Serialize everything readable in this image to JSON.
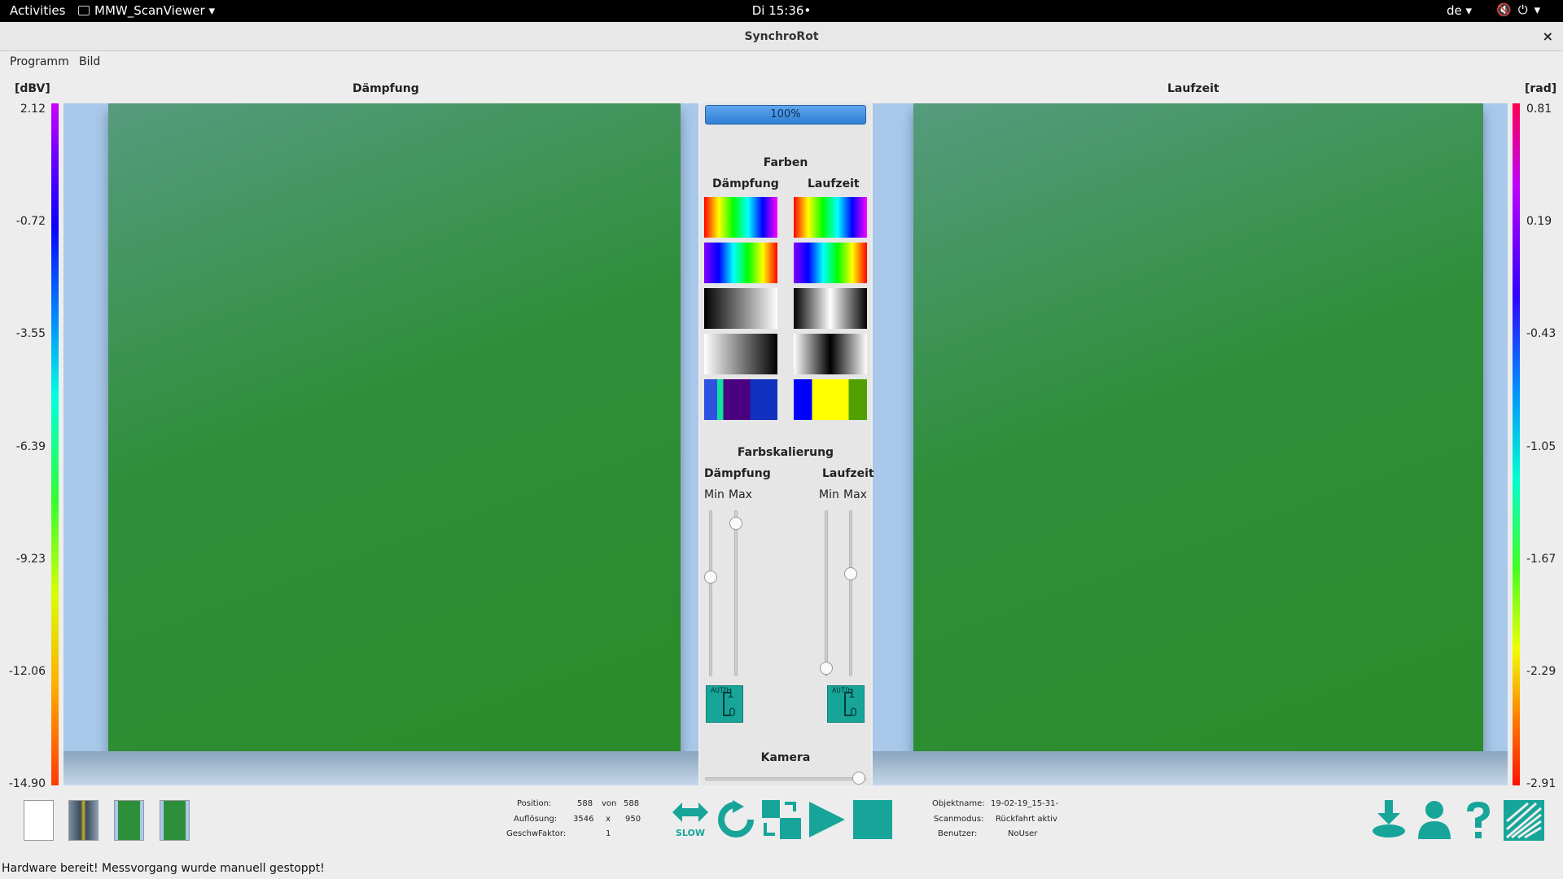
{
  "topbar": {
    "activities": "Activities",
    "app_menu": "MMW_ScanViewer",
    "clock": "Di 15:36",
    "language": "de"
  },
  "window": {
    "title": "SynchroRot",
    "close": "×"
  },
  "menu": {
    "items": [
      "Programm",
      "Bild"
    ]
  },
  "left_panel": {
    "title": "Dämpfung",
    "unit": "[dBV]",
    "ticks": [
      "2.12",
      "-0.72",
      "-3.55",
      "-6.39",
      "-9.23",
      "-12.06",
      "-14.90"
    ]
  },
  "right_panel": {
    "title": "Laufzeit",
    "unit": "[rad]",
    "ticks": [
      "0.81",
      "0.19",
      "-0.43",
      "-1.05",
      "-1.67",
      "-2.29",
      "-2.91"
    ]
  },
  "controls": {
    "progress_text": "100%",
    "progress_value": 1.0,
    "farben_title": "Farben",
    "farben_damp": "Dämpfung",
    "farben_lauf": "Laufzeit",
    "skalierung_title": "Farbskalierung",
    "skal_damp": "Dämpfung",
    "skal_lauf": "Laufzeit",
    "min": "Min",
    "max": "Max",
    "auto_text": "AUTO",
    "auto_one": "1",
    "auto_zero": "0",
    "kamera_title": "Kamera",
    "slider_levels": {
      "damp_min": 0.6,
      "damp_max": 0.92,
      "lauf_min": 0.05,
      "lauf_max": 0.62,
      "kamera": 1.0
    }
  },
  "info": {
    "position_label": "Position:",
    "position_value": "588",
    "von": "von",
    "position_total": "588",
    "aufloesung_label": "Auflösung:",
    "aufloesung_w": "3546",
    "x": "x",
    "aufloesung_h": "950",
    "geschw_label": "GeschwFaktor:",
    "geschw_value": "1",
    "objektname_label": "Objektname:",
    "objektname_value": "19-02-19_15-31-",
    "scanmodus_label": "Scanmodus:",
    "scanmodus_value": "Rückfahrt aktiv",
    "benutzer_label": "Benutzer:",
    "benutzer_value": "NoUser"
  },
  "toolbar": {
    "slow_label": "SLOW",
    "accent": "#17a59a"
  },
  "status": {
    "text": "Hardware bereit!  Messvorgang wurde manuell gestoppt!"
  }
}
